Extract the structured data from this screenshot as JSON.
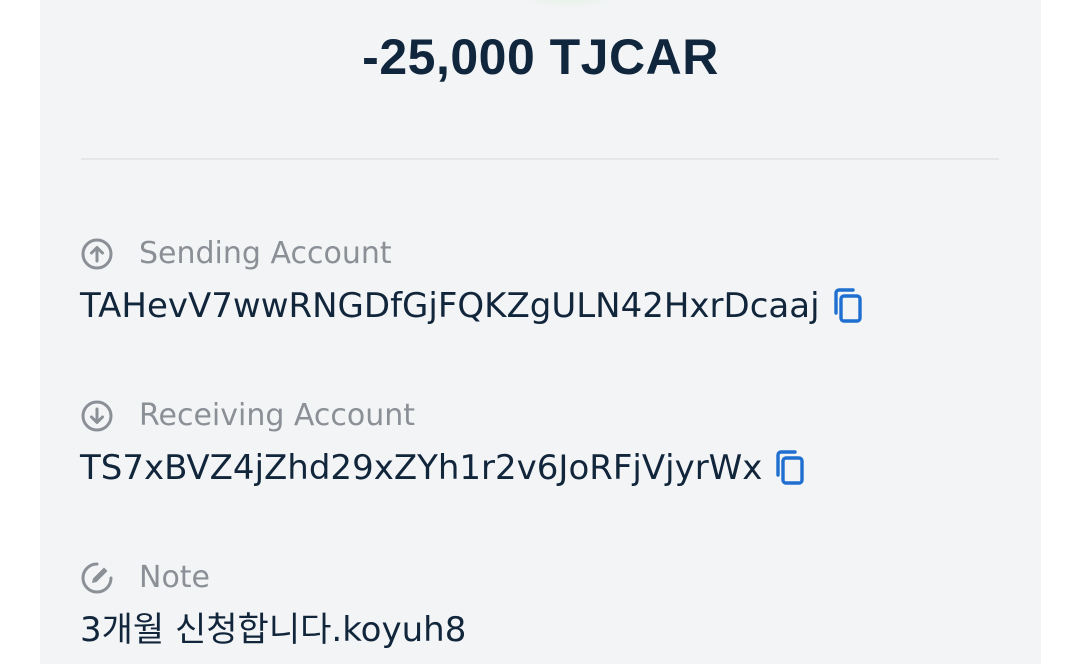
{
  "transaction": {
    "amount": "-25,000 TJCAR"
  },
  "details": {
    "sending": {
      "label": "Sending Account",
      "value": "TAHevV7wwRNGDfGjFQKZgULN42HxrDcaaj"
    },
    "receiving": {
      "label": "Receiving Account",
      "value": "TS7xBVZ4jZhd29xZYh1r2v6JoRFjVjyrWx"
    },
    "note": {
      "label": "Note",
      "value": "3개월 신청합니다.koyuh8"
    }
  },
  "icons": {
    "sending": "arrow-up-circle-icon",
    "receiving": "arrow-down-circle-icon",
    "note": "edit-circle-icon",
    "copy": "copy-icon"
  },
  "colors": {
    "card_background": "#f3f4f6",
    "amount_text": "#10263d",
    "label_text": "#8b9097",
    "value_text": "#11253b",
    "icon_gray": "#8b9097",
    "copy_blue": "#1f6fd1",
    "status_green": "#c8e6c8"
  }
}
